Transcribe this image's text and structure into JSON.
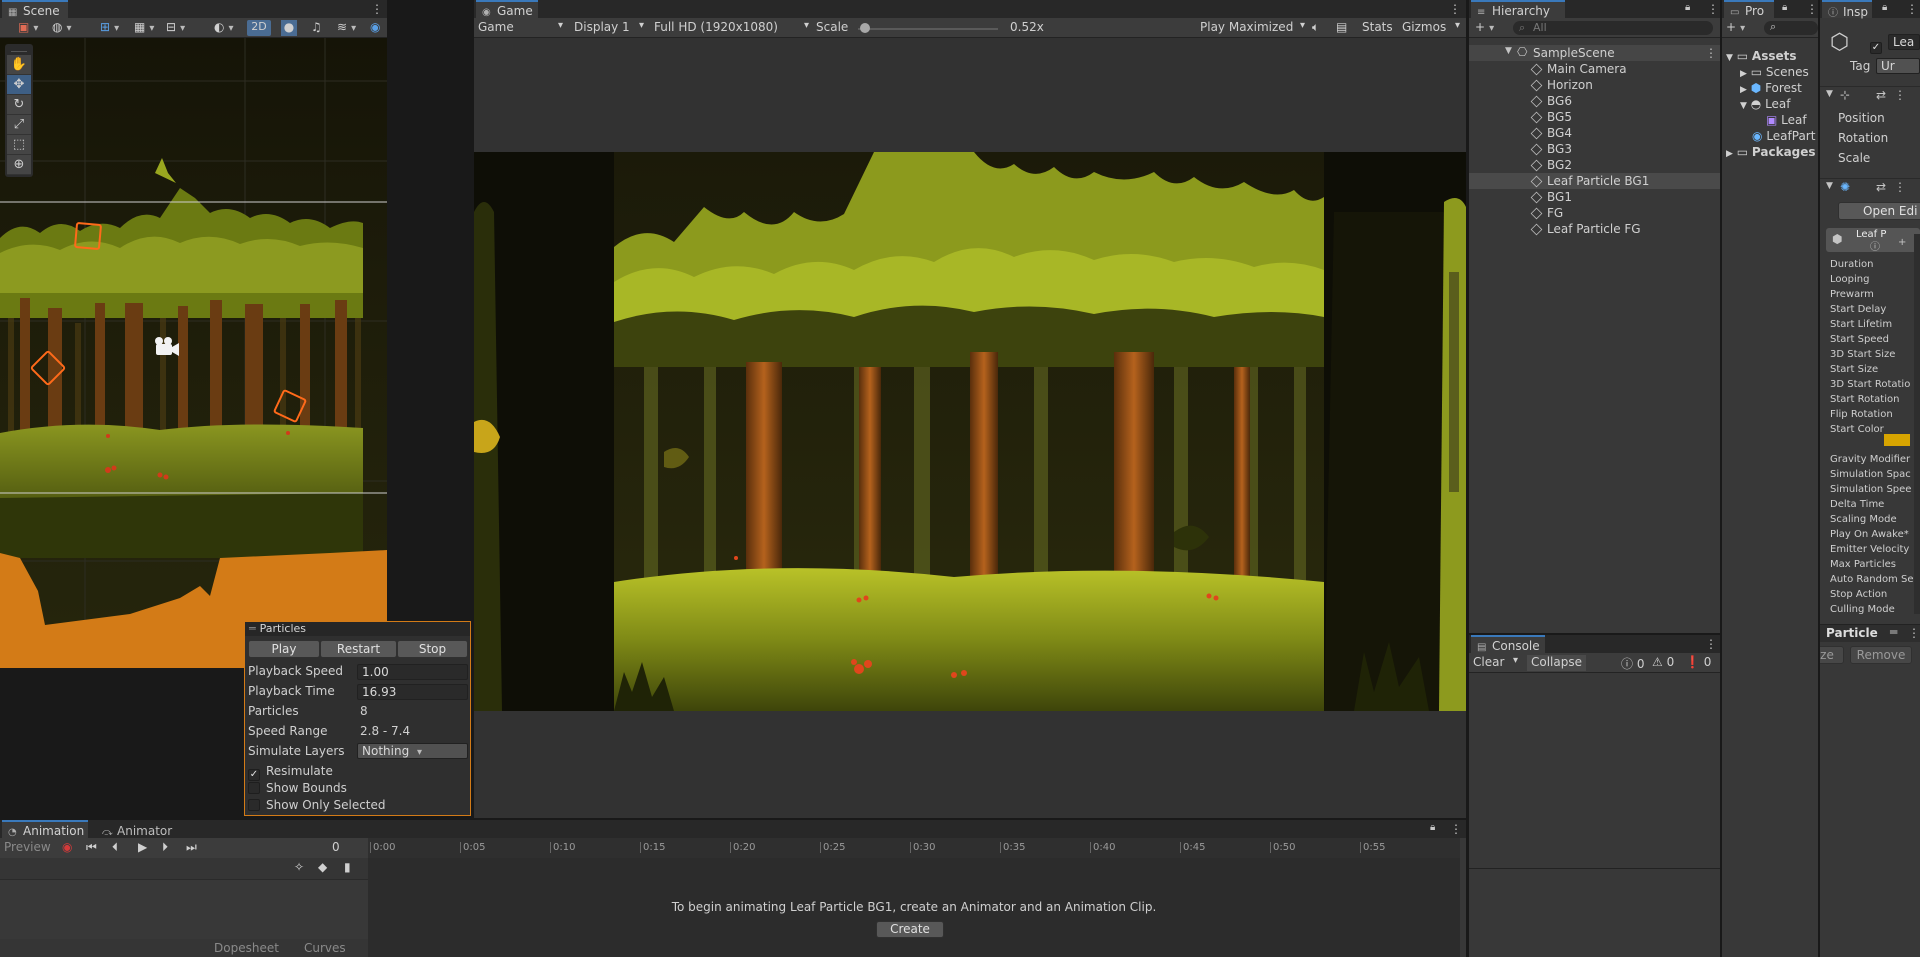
{
  "scene": {
    "tab": "Scene",
    "mode_2d": "2D",
    "tools": [
      "hand-tool",
      "move-tool",
      "rotate-tool",
      "scale-tool",
      "rect-tool",
      "transform-tool"
    ]
  },
  "particles": {
    "title": "Particles",
    "play": "Play",
    "restart": "Restart",
    "stop": "Stop",
    "rows": [
      {
        "label": "Playback Speed",
        "value": "1.00"
      },
      {
        "label": "Playback Time",
        "value": "16.93"
      },
      {
        "label": "Particles",
        "value": "8"
      },
      {
        "label": "Speed Range",
        "value": "2.8 - 7.4"
      },
      {
        "label": "Simulate Layers",
        "value": "Nothing"
      }
    ],
    "resimulate": "Resimulate",
    "show_bounds": "Show Bounds",
    "show_only_selected": "Show Only Selected"
  },
  "game": {
    "tab": "Game",
    "mode": "Game",
    "display": "Display 1",
    "resolution": "Full HD (1920x1080)",
    "scale_label": "Scale",
    "scale_value": "0.52x",
    "scale_level": 0.05,
    "play_maximized": "Play Maximized",
    "stats": "Stats",
    "gizmos": "Gizmos"
  },
  "hierarchy": {
    "tab": "Hierarchy",
    "search_placeholder": "All",
    "scene": "SampleScene",
    "items": [
      "Main Camera",
      "Horizon",
      "BG6",
      "BG5",
      "BG4",
      "BG3",
      "BG2",
      "Leaf Particle BG1",
      "BG1",
      "FG",
      "Leaf Particle FG"
    ],
    "selected_index": 7
  },
  "project": {
    "tab": "Pro",
    "assets": "Assets",
    "scenes": "Scenes",
    "forest": "Forest",
    "leaf": "Leaf",
    "leaf_child": "Leaf",
    "leaf_part": "LeafPart",
    "packages": "Packages"
  },
  "inspector": {
    "tab": "Insp",
    "name": "Lea",
    "tag_label": "Tag",
    "tag_value": "Ur",
    "transform": [
      "Position",
      "Rotation",
      "Scale"
    ],
    "open_editor": "Open Edi",
    "leaf_label": "Leaf P",
    "props": [
      "Duration",
      "Looping",
      "Prewarm",
      "Start Delay",
      "Start Lifetim",
      "Start Speed",
      "3D Start Size",
      "Start Size",
      "3D Start Rotatio",
      "Start Rotation",
      "Flip Rotation",
      "Start Color",
      "",
      "Gravity Modifier",
      "Simulation Spac",
      "Simulation Spee",
      "Delta Time",
      "Scaling Mode",
      "Play On Awake*",
      "Emitter Velocity",
      "Max Particles",
      "Auto Random Se",
      "Stop Action",
      "Culling Mode"
    ],
    "particle_header": "Particle",
    "size_btn": "ze",
    "remove_btn": "Remove",
    "color_swatch": "#d7a400"
  },
  "console": {
    "tab": "Console",
    "clear": "Clear",
    "collapse": "Collapse",
    "info_count": "0",
    "warn_count": "0",
    "error_count": "0"
  },
  "animation": {
    "tab": "Animation",
    "animator_tab": "Animator",
    "preview": "Preview",
    "frame": "0",
    "ticks": [
      "0:00",
      "0:05",
      "0:10",
      "0:15",
      "0:20",
      "0:25",
      "0:30",
      "0:35",
      "0:40",
      "0:45",
      "0:50",
      "0:55"
    ],
    "message": "To begin animating Leaf Particle BG1, create an Animator and an Animation Clip.",
    "create": "Create",
    "dopesheet": "Dopesheet",
    "curves": "Curves"
  },
  "colors": {
    "accent": "#3a79bb",
    "particle_frame": "#d37b17",
    "gizmo_orange": "#ff6a1a"
  }
}
